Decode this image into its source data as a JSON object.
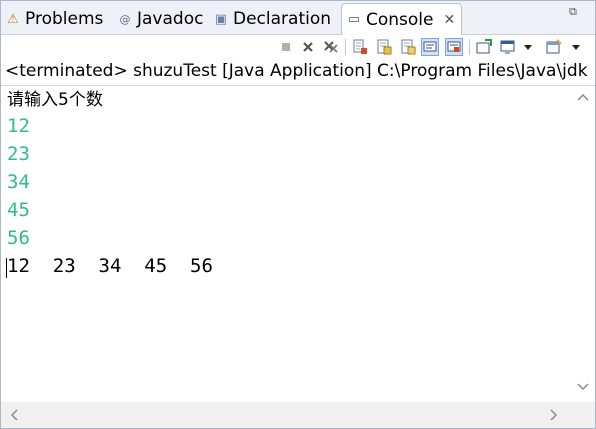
{
  "tabs": [
    {
      "label": "Problems",
      "icon": "problems-icon",
      "glyph": "⚠"
    },
    {
      "label": "Javadoc",
      "icon": "javadoc-icon",
      "glyph": "@"
    },
    {
      "label": "Declaration",
      "icon": "declaration-icon",
      "glyph": "▣"
    },
    {
      "label": "Console",
      "icon": "console-icon",
      "glyph": "▭",
      "active": true
    }
  ],
  "tab_close": "✕",
  "maximize_glyph": "⧉",
  "toolbar": {
    "icons": [
      "terminate-icon",
      "remove-launch-icon",
      "remove-all-terminated-icon",
      "clear-console-icon",
      "scroll-lock-icon",
      "word-wrap-icon",
      "show-on-output-icon",
      "show-on-error-icon",
      "pin-console-icon",
      "display-console-icon",
      "display-console-dropdown-icon",
      "open-console-icon",
      "open-console-dropdown-icon"
    ]
  },
  "status_line": "<terminated> shuzuTest [Java Application] C:\\Program Files\\Java\\jdk",
  "console": {
    "prompt": "请输入5个数",
    "inputs": [
      "12",
      "23",
      "34",
      "45",
      "56"
    ],
    "output": "12  23  34  45  56"
  },
  "colors": {
    "input_text": "#2fba8f",
    "tab_bar_bg": "#eef2f8"
  }
}
